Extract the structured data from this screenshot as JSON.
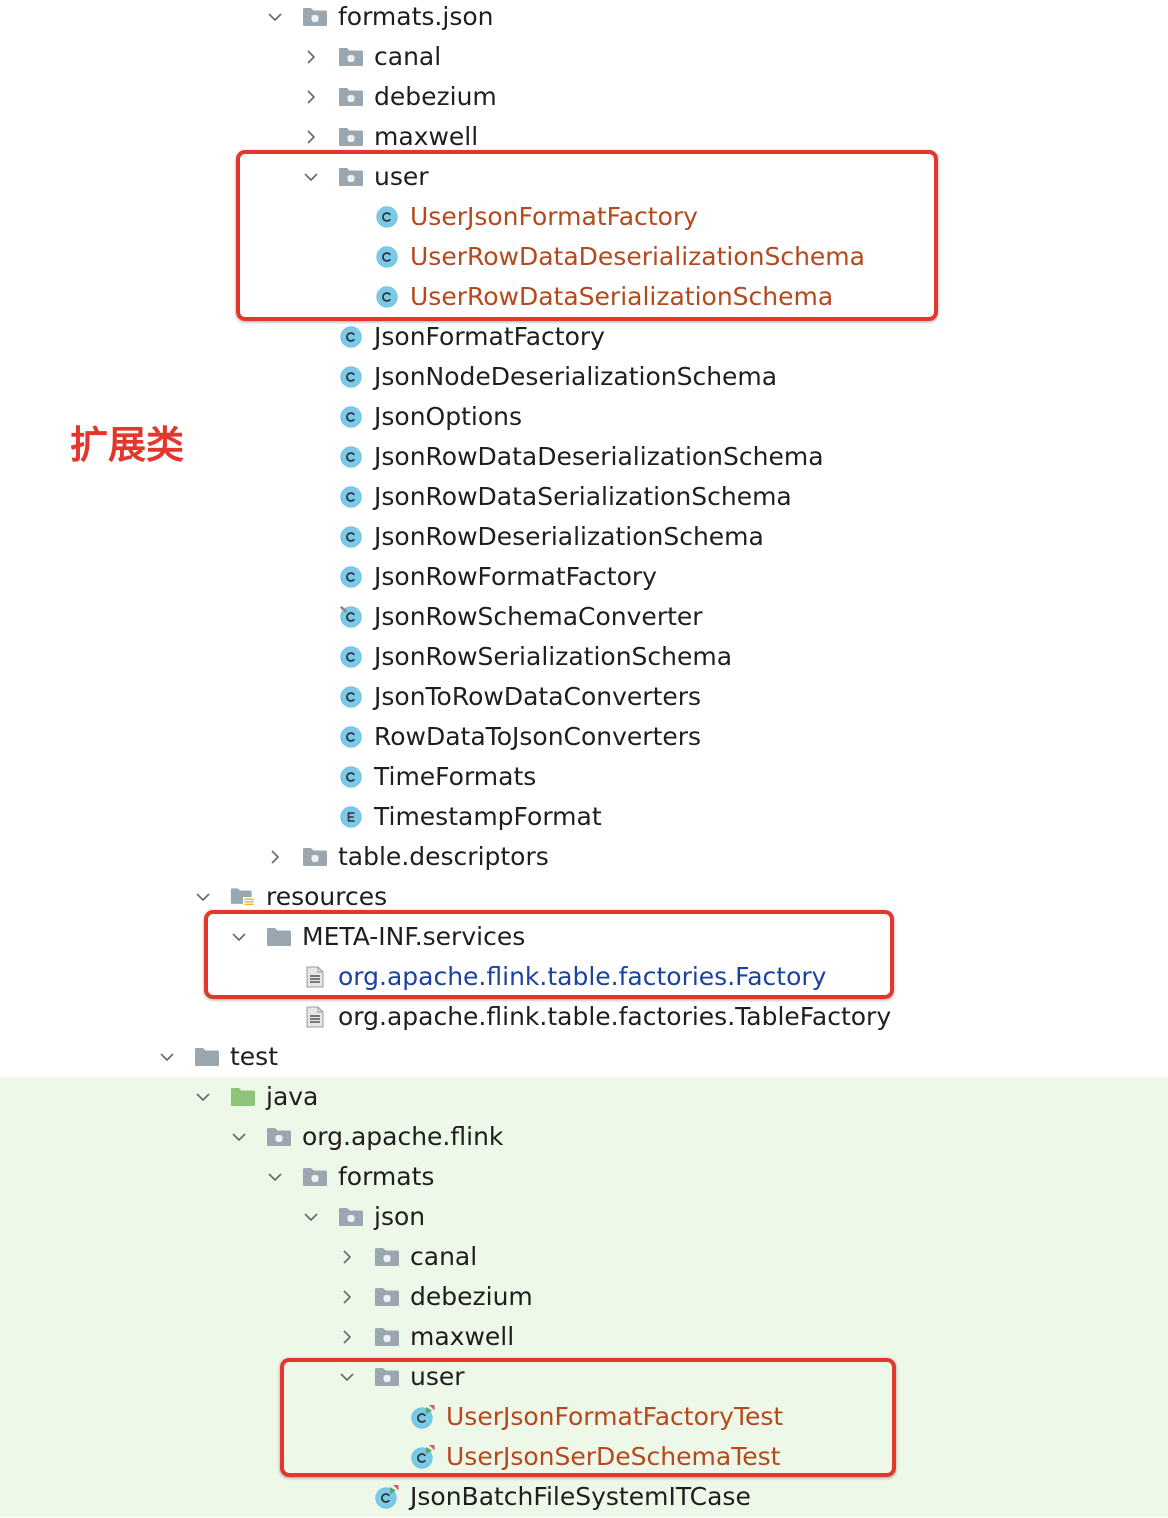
{
  "colors": {
    "text": "#1e1e1e",
    "unversioned_text": "#b5481c",
    "modified_text": "#1b42a0",
    "annotation": "#e3372d",
    "test_scope_bg": "#eef8e8",
    "folder": "#9aa7b0",
    "source_folder": "#8ec47a",
    "class_icon": "#79c9e8",
    "resource_lines": "#e7b53a",
    "chevron": "#6e6e6e"
  },
  "annotation": {
    "label": "扩展类"
  },
  "tree": [
    {
      "label": "formats.json",
      "depth": 3,
      "icon": "package-folder-icon",
      "expanded": true
    },
    {
      "label": "canal",
      "depth": 4,
      "icon": "package-folder-icon",
      "expanded": false
    },
    {
      "label": "debezium",
      "depth": 4,
      "icon": "package-folder-icon",
      "expanded": false
    },
    {
      "label": "maxwell",
      "depth": 4,
      "icon": "package-folder-icon",
      "expanded": false
    },
    {
      "label": "user",
      "depth": 4,
      "icon": "package-folder-icon",
      "expanded": true
    },
    {
      "label": "UserJsonFormatFactory",
      "depth": 5,
      "icon": "class-icon",
      "text_color": "#b5481c"
    },
    {
      "label": "UserRowDataDeserializationSchema",
      "depth": 5,
      "icon": "class-icon",
      "text_color": "#b5481c"
    },
    {
      "label": "UserRowDataSerializationSchema",
      "depth": 5,
      "icon": "class-icon",
      "text_color": "#b5481c"
    },
    {
      "label": "JsonFormatFactory",
      "depth": 4,
      "icon": "class-icon"
    },
    {
      "label": "JsonNodeDeserializationSchema",
      "depth": 4,
      "icon": "class-icon"
    },
    {
      "label": "JsonOptions",
      "depth": 4,
      "icon": "class-icon"
    },
    {
      "label": "JsonRowDataDeserializationSchema",
      "depth": 4,
      "icon": "class-icon"
    },
    {
      "label": "JsonRowDataSerializationSchema",
      "depth": 4,
      "icon": "class-icon"
    },
    {
      "label": "JsonRowDeserializationSchema",
      "depth": 4,
      "icon": "class-icon"
    },
    {
      "label": "JsonRowFormatFactory",
      "depth": 4,
      "icon": "class-icon"
    },
    {
      "label": "JsonRowSchemaConverter",
      "depth": 4,
      "icon": "class-marked-icon"
    },
    {
      "label": "JsonRowSerializationSchema",
      "depth": 4,
      "icon": "class-icon"
    },
    {
      "label": "JsonToRowDataConverters",
      "depth": 4,
      "icon": "class-icon"
    },
    {
      "label": "RowDataToJsonConverters",
      "depth": 4,
      "icon": "class-icon"
    },
    {
      "label": "TimeFormats",
      "depth": 4,
      "icon": "class-icon"
    },
    {
      "label": "TimestampFormat",
      "depth": 4,
      "icon": "enum-icon"
    },
    {
      "label": "table.descriptors",
      "depth": 3,
      "icon": "package-folder-icon",
      "expanded": false
    },
    {
      "label": "resources",
      "depth": 1,
      "icon": "resources-folder-icon",
      "expanded": true
    },
    {
      "label": "META-INF.services",
      "depth": 2,
      "icon": "folder-icon",
      "expanded": true
    },
    {
      "label": "org.apache.flink.table.factories.Factory",
      "depth": 3,
      "icon": "text-file-icon",
      "text_color": "#1b42a0"
    },
    {
      "label": "org.apache.flink.table.factories.TableFactory",
      "depth": 3,
      "icon": "text-file-icon"
    },
    {
      "label": "test",
      "depth": 0,
      "icon": "folder-icon",
      "expanded": true
    },
    {
      "label": "java",
      "depth": 1,
      "icon": "source-folder-icon",
      "expanded": true,
      "row_color": "#eef8e8"
    },
    {
      "label": "org.apache.flink",
      "depth": 2,
      "icon": "package-folder-icon",
      "expanded": true,
      "row_color": "#eef8e8"
    },
    {
      "label": "formats",
      "depth": 3,
      "icon": "package-folder-icon",
      "expanded": true,
      "row_color": "#eef8e8"
    },
    {
      "label": "json",
      "depth": 4,
      "icon": "package-folder-icon",
      "expanded": true,
      "row_color": "#eef8e8"
    },
    {
      "label": "canal",
      "depth": 5,
      "icon": "package-folder-icon",
      "expanded": false,
      "row_color": "#eef8e8"
    },
    {
      "label": "debezium",
      "depth": 5,
      "icon": "package-folder-icon",
      "expanded": false,
      "row_color": "#eef8e8"
    },
    {
      "label": "maxwell",
      "depth": 5,
      "icon": "package-folder-icon",
      "expanded": false,
      "row_color": "#eef8e8"
    },
    {
      "label": "user",
      "depth": 5,
      "icon": "package-folder-icon",
      "expanded": true,
      "row_color": "#eef8e8"
    },
    {
      "label": "UserJsonFormatFactoryTest",
      "depth": 6,
      "icon": "test-class-icon",
      "text_color": "#b5481c",
      "row_color": "#eef8e8"
    },
    {
      "label": "UserJsonSerDeSchemaTest",
      "depth": 6,
      "icon": "test-class-icon",
      "text_color": "#b5481c",
      "row_color": "#eef8e8"
    },
    {
      "label": "JsonBatchFileSystemITCase",
      "depth": 5,
      "icon": "test-class-icon",
      "row_color": "#eef8e8"
    }
  ]
}
